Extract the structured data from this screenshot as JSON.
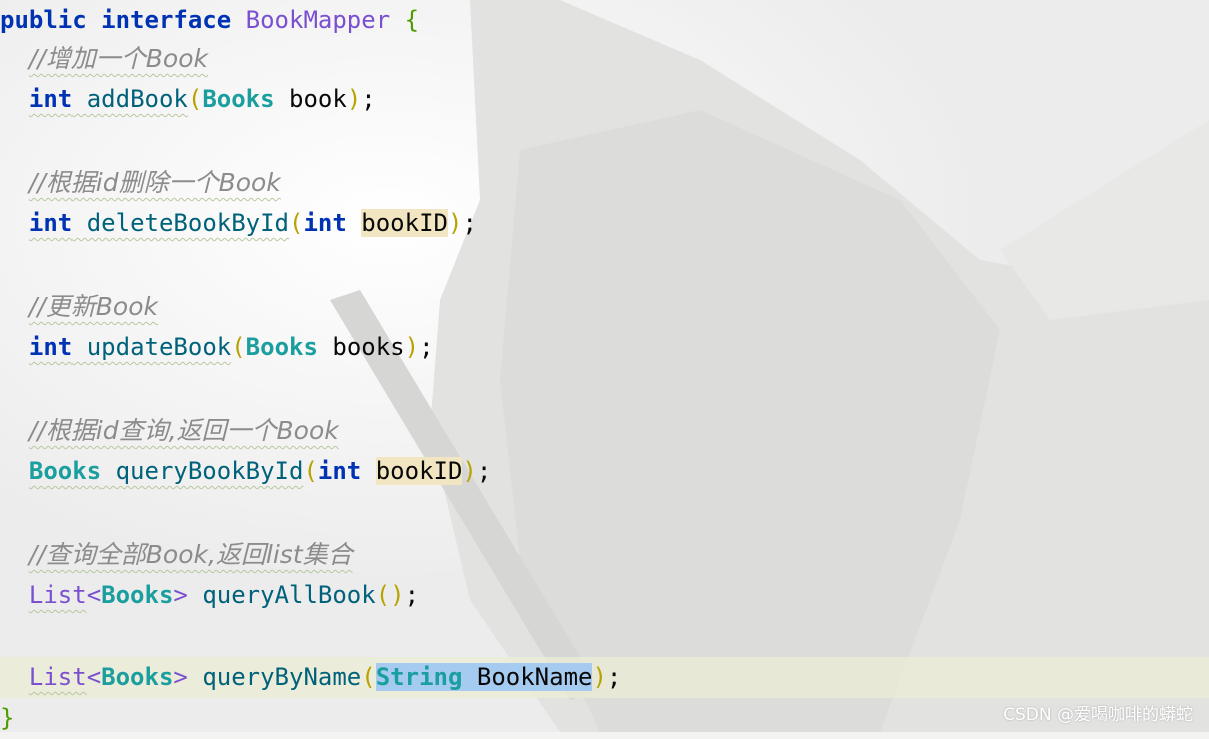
{
  "code": {
    "line_1": {
      "kw1": "public",
      "kw2": "interface",
      "name": "BookMapper",
      "brace": "{"
    },
    "line_2": {
      "comment": "//增加一个Book"
    },
    "line_3": {
      "ret": "int",
      "fn": "addBook",
      "open": "(",
      "ptype": "Books",
      "pname": "book",
      "close": ")",
      "end": ";"
    },
    "line_5": {
      "comment": "//根据id删除一个Book"
    },
    "line_6": {
      "ret": "int",
      "fn": "deleteBookById",
      "open": "(",
      "ptype": "int",
      "pname": "bookID",
      "close": ")",
      "end": ";"
    },
    "line_8": {
      "comment": "//更新Book"
    },
    "line_9": {
      "ret": "int",
      "fn": "updateBook",
      "open": "(",
      "ptype": "Books",
      "pname": "books",
      "close": ")",
      "end": ";"
    },
    "line_11": {
      "comment": "//根据id查询,返回一个Book"
    },
    "line_12": {
      "ret": "Books",
      "fn": "queryBookById",
      "open": "(",
      "ptype": "int",
      "pname": "bookID",
      "close": ")",
      "end": ";"
    },
    "line_14": {
      "comment": "//查询全部Book,返回list集合"
    },
    "line_15": {
      "ret_outer": "List",
      "lt": "<",
      "ret_inner": "Books",
      "gt": ">",
      "fn": "queryAllBook",
      "open": "(",
      "close": ")",
      "end": ";"
    },
    "line_17": {
      "ret_outer": "List",
      "lt": "<",
      "ret_inner": "Books",
      "gt": ">",
      "fn": "queryByName",
      "open": "(",
      "ptype": "String",
      "pname": "BookName",
      "close": ")",
      "end": ";"
    },
    "line_18": {
      "brace": "}"
    }
  },
  "watermark": "CSDN @爱喝咖啡的蟒蛇",
  "colors": {
    "keyword": "#0033b3",
    "type": "#1a9e9e",
    "interface": "#7a4fd0",
    "method": "#00627a",
    "comment": "#8c8c8c",
    "selection": "#a6cbf0",
    "usage_highlight": "#f2e6c2",
    "current_line": "#ececd4"
  }
}
